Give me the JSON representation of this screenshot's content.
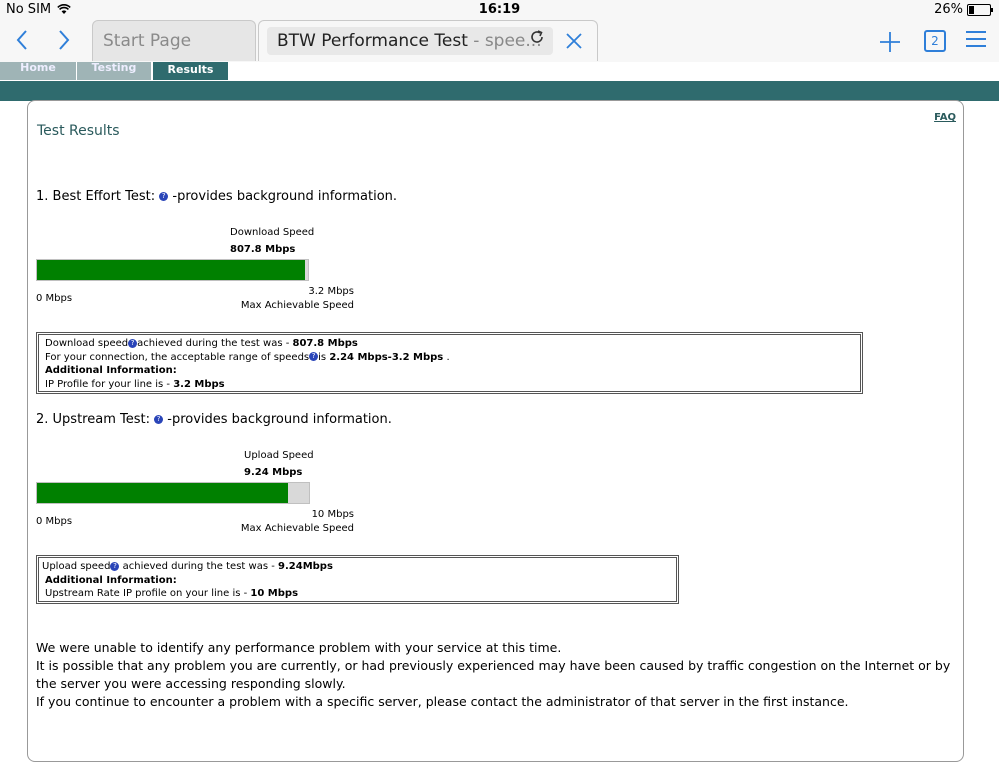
{
  "status": {
    "carrier": "No SIM",
    "time": "16:19",
    "battery": "26%",
    "battery_level": 0.26
  },
  "browser": {
    "tabs": [
      {
        "label": "Start Page"
      },
      {
        "label": "BTW Performance Test",
        "label_suffix": " - spee..."
      }
    ],
    "tab_count": "2",
    "icons": [
      "back-icon",
      "forward-icon",
      "reload-icon",
      "close-icon",
      "plus-icon",
      "tabs-icon",
      "menu-icon"
    ]
  },
  "site_nav": {
    "items": [
      "Home",
      "Testing",
      "Results"
    ],
    "active": "Results"
  },
  "page": {
    "faq": "FAQ",
    "title": "Test Results",
    "best_effort": {
      "heading": "1. Best Effort Test:",
      "heading_suffix": "-provides background information.",
      "speed_label": "Download Speed",
      "speed_value": "807.8 Mbps",
      "min_label": "0 Mbps",
      "max_value": "3.2 Mbps",
      "max_label": "Max Achievable Speed",
      "fill_fraction": 0.99,
      "info": {
        "line1_prefix": "Download speed",
        "line1_mid": "achieved during the test was - ",
        "line1_value": "807.8 Mbps",
        "line2_prefix": "For your connection, the acceptable range of speeds",
        "line2_mid": "is ",
        "line2_value": "2.24 Mbps-3.2 Mbps",
        "line2_suffix": " .",
        "line3": "Additional Information:",
        "line4_prefix": "IP Profile for your line is - ",
        "line4_value": "3.2 Mbps"
      }
    },
    "upstream": {
      "heading": "2. Upstream Test:",
      "heading_suffix": "-provides background information.",
      "speed_label": "Upload Speed",
      "speed_value": "9.24 Mbps",
      "min_label": "0 Mbps",
      "max_value": "10 Mbps",
      "max_label": "Max Achievable Speed",
      "fill_fraction": 0.924,
      "info": {
        "line1_prefix": "Upload speed",
        "line1_mid": " achieved during the test was - ",
        "line1_value": "9.24Mbps",
        "line2": "Additional Information:",
        "line3_prefix": "Upstream Rate IP profile on your line is - ",
        "line3_value": "10 Mbps"
      }
    },
    "summary": [
      "We were unable to identify any performance problem with your service at this time.",
      "It is possible that any problem you are currently, or had previously experienced may have been caused by traffic congestion on the Internet or by the server you were accessing responding slowly.",
      "If you continue to encounter a problem with a specific server, please contact the administrator of that server in the first instance."
    ]
  }
}
